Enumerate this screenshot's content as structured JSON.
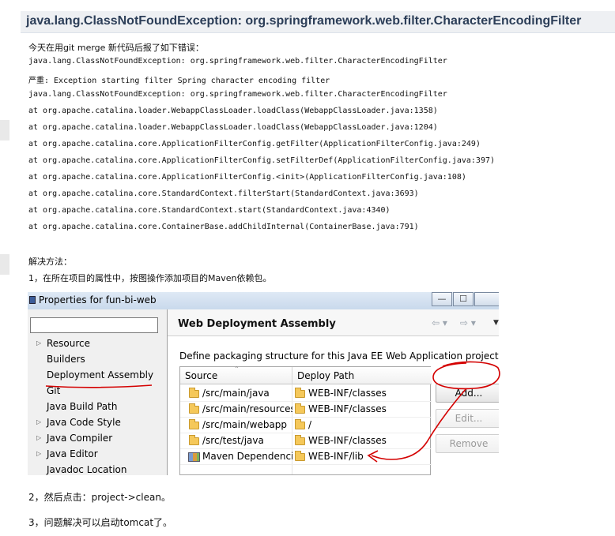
{
  "article": {
    "title": "java.lang.ClassNotFoundException: org.springframework.web.filter.CharacterEncodingFilter",
    "intro": "今天在用git merge 新代码后报了如下错误：",
    "error_lines": [
      "java.lang.ClassNotFoundException: org.springframework.web.filter.CharacterEncodingFilter",
      "严重: Exception starting filter Spring character encoding filter",
      "java.lang.ClassNotFoundException: org.springframework.web.filter.CharacterEncodingFilter",
      " at org.apache.catalina.loader.WebappClassLoader.loadClass(WebappClassLoader.java:1358)",
      " at org.apache.catalina.loader.WebappClassLoader.loadClass(WebappClassLoader.java:1204)",
      " at org.apache.catalina.core.ApplicationFilterConfig.getFilter(ApplicationFilterConfig.java:249)",
      " at org.apache.catalina.core.ApplicationFilterConfig.setFilterDef(ApplicationFilterConfig.java:397)",
      " at org.apache.catalina.core.ApplicationFilterConfig.<init>(ApplicationFilterConfig.java:108)",
      " at org.apache.catalina.core.StandardContext.filterStart(StandardContext.java:3693)",
      " at org.apache.catalina.core.StandardContext.start(StandardContext.java:4340)",
      " at org.apache.catalina.core.ContainerBase.addChildInternal(ContainerBase.java:791)"
    ],
    "solution_heading": "解决方法：",
    "step1": "1，在所在项目的属性中，按图操作添加项目的Maven依赖包。",
    "step2": "2，然后点击：project->clean。",
    "step3": "3，问题解决可以启动tomcat了。"
  },
  "dialog": {
    "title": "Properties for fun-bi-web",
    "window_buttons": {
      "minimize": "—",
      "maximize": "☐"
    },
    "filter_value": "",
    "nav_items": [
      {
        "label": "Resource",
        "expandable": true
      },
      {
        "label": "Builders",
        "expandable": false
      },
      {
        "label": "Deployment Assembly",
        "expandable": false,
        "selected": true
      },
      {
        "label": "Git",
        "expandable": false
      },
      {
        "label": "Java Build Path",
        "expandable": false
      },
      {
        "label": "Java Code Style",
        "expandable": true
      },
      {
        "label": "Java Compiler",
        "expandable": true
      },
      {
        "label": "Java Editor",
        "expandable": true
      },
      {
        "label": "Javadoc Location",
        "expandable": false
      }
    ],
    "panel": {
      "heading": "Web Deployment Assembly",
      "nav_back": "⇦ ▾",
      "nav_forward": "⇨ ▾",
      "menu": "▼",
      "description": "Define packaging structure for this Java EE Web Application project.",
      "columns": [
        "Source",
        "Deploy Path"
      ],
      "rows": [
        {
          "source": "/src/main/java",
          "deploy": "WEB-INF/classes",
          "icon": "folder-icon"
        },
        {
          "source": "/src/main/resources",
          "deploy": "WEB-INF/classes",
          "icon": "folder-icon"
        },
        {
          "source": "/src/main/webapp",
          "deploy": "/",
          "icon": "folder-icon"
        },
        {
          "source": "/src/test/java",
          "deploy": "WEB-INF/classes",
          "icon": "folder-icon"
        },
        {
          "source": "Maven Dependencies",
          "deploy": "WEB-INF/lib",
          "icon": "library-icon"
        }
      ],
      "buttons": {
        "add": "Add...",
        "edit": "Edit...",
        "remove": "Remove"
      }
    }
  },
  "annotation_color": "#d40000"
}
